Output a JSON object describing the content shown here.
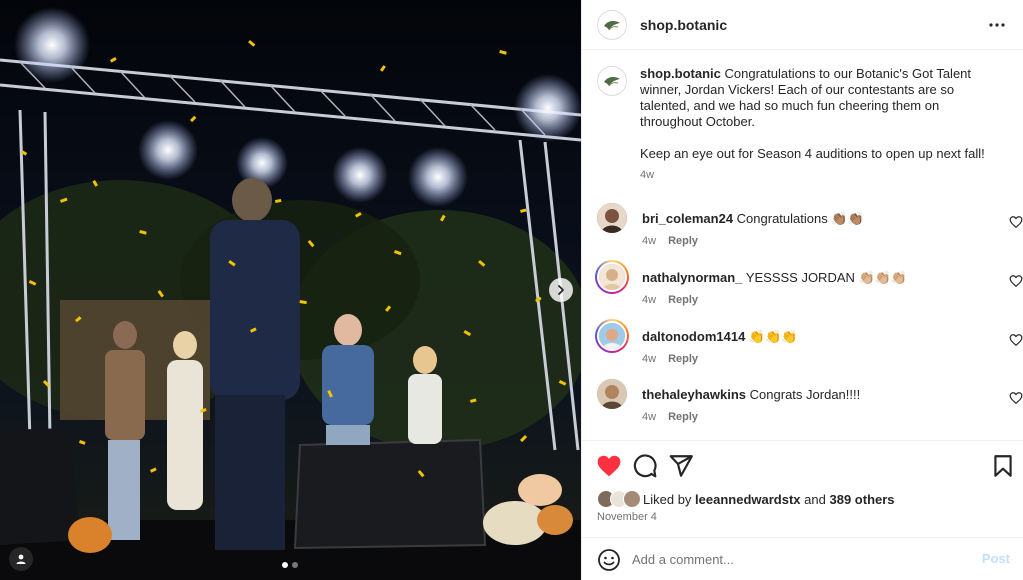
{
  "post": {
    "username": "shop.botanic",
    "caption_p1": "Congratulations to our Botanic's Got Talent winner, Jordan Vickers! Each of our contestants are so talented, and we had so much fun cheering them on throughout October.",
    "caption_p2": "Keep an eye out for Season 4 auditions to open up next fall!",
    "caption_time": "4w"
  },
  "comments": [
    {
      "username": "bri_coleman24",
      "text": "Congratulations 👏🏽👏🏽",
      "time": "4w",
      "reply_label": "Reply",
      "avatar_color": "#6b4a3a",
      "story_ring": false
    },
    {
      "username": "nathalynorman_",
      "text": "YESSSS JORDAN 👏🏼👏🏼👏🏼",
      "time": "4w",
      "reply_label": "Reply",
      "avatar_color": "#c9a27e",
      "story_ring": true
    },
    {
      "username": "daltonodom1414",
      "text": "👏👏👏",
      "time": "4w",
      "reply_label": "Reply",
      "avatar_color": "#d88a6a",
      "story_ring": true
    },
    {
      "username": "thehaleyhawkins",
      "text": "Congrats Jordan!!!!",
      "time": "4w",
      "reply_label": "Reply",
      "avatar_color": "#a0785a",
      "story_ring": false
    }
  ],
  "likes": {
    "prefix": "Liked by",
    "user": "leeannedwardstx",
    "connector": "and",
    "others": "389 others",
    "date": "November 4"
  },
  "composer": {
    "placeholder": "Add a comment...",
    "post_label": "Post"
  },
  "colors": {
    "like_red": "#ff3040",
    "post_disabled_blue": "#c3e1fc",
    "confetti_gold": "#f2c200"
  },
  "carousel": {
    "current": 1,
    "total": 2
  }
}
